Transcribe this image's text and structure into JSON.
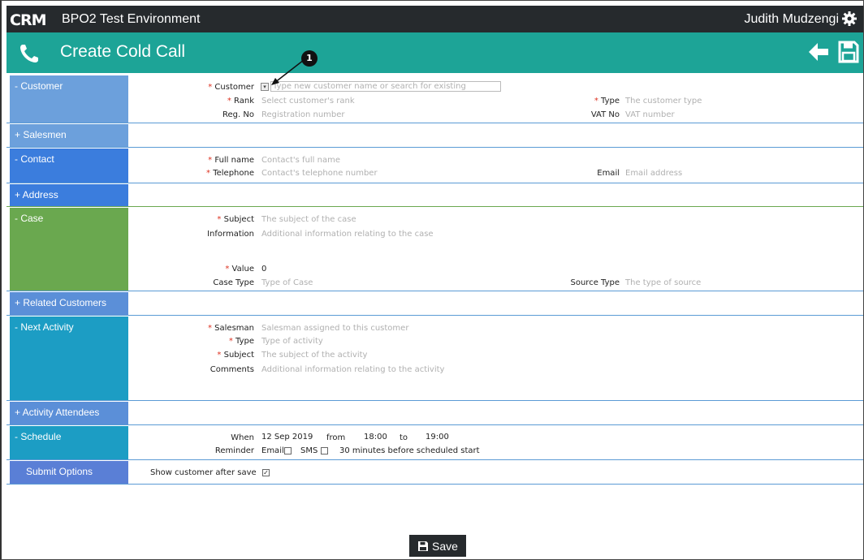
{
  "header": {
    "env_title": "BPO2 Test Environment",
    "user_name": "Judith Mudzengi"
  },
  "page": {
    "title": "Create Cold Call"
  },
  "callout": "1",
  "sections": {
    "customer": {
      "label": "- Customer",
      "customer_label": "Customer",
      "customer_placeholder": "Type new customer name or search for existing customer",
      "rank_label": "Rank",
      "rank_placeholder": "Select customer's rank",
      "regno_label": "Reg. No",
      "regno_placeholder": "Registration number",
      "type_label": "Type",
      "type_placeholder": "The customer type",
      "vat_label": "VAT No",
      "vat_placeholder": "VAT number"
    },
    "salesmen": {
      "label": "+ Salesmen"
    },
    "contact": {
      "label": "- Contact",
      "fullname_label": "Full name",
      "fullname_placeholder": "Contact's full name",
      "telephone_label": "Telephone",
      "telephone_placeholder": "Contact's telephone number",
      "email_label": "Email",
      "email_placeholder": "Email address"
    },
    "address": {
      "label": "+ Address"
    },
    "case": {
      "label": "- Case",
      "subject_label": "Subject",
      "subject_placeholder": "The subject of the case",
      "information_label": "Information",
      "information_placeholder": "Additional information relating to the case",
      "value_label": "Value",
      "value": "0",
      "casetype_label": "Case Type",
      "casetype_placeholder": "Type of Case",
      "sourcetype_label": "Source Type",
      "sourcetype_placeholder": "The type of source"
    },
    "related": {
      "label": "+ Related Customers"
    },
    "next_activity": {
      "label": "- Next Activity",
      "salesman_label": "Salesman",
      "salesman_placeholder": "Salesman assigned to this customer",
      "type_label": "Type",
      "type_placeholder": "Type of activity",
      "subject_label": "Subject",
      "subject_placeholder": "The subject of the activity",
      "comments_label": "Comments",
      "comments_placeholder": "Additional information relating to the activity"
    },
    "attendees": {
      "label": "+ Activity Attendees"
    },
    "schedule": {
      "label": "- Schedule",
      "when_label": "When",
      "date": "12 Sep 2019",
      "from_label": "from",
      "from_time": "18:00",
      "to_label": "to",
      "to_time": "19:00",
      "reminder_label": "Reminder",
      "email_label": "Email",
      "sms_label": "SMS",
      "reminder_text": "30 minutes before scheduled start"
    },
    "submit": {
      "label": "Submit Options",
      "show_customer_label": "Show customer after save"
    }
  },
  "footer": {
    "save_label": "Save"
  },
  "colors": {
    "topbar": "#262a2d",
    "header": "#1da497",
    "required": "#dd3322"
  }
}
